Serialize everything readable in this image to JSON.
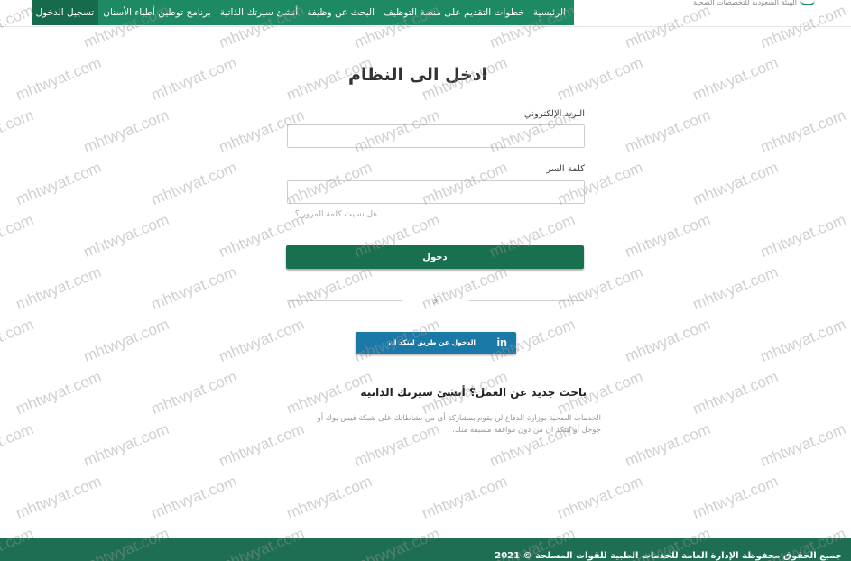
{
  "header": {
    "brand_text": "الهيئة السعودية للتخصصات الصحية",
    "nav_items": [
      {
        "label": "الرئيسية",
        "active": false
      },
      {
        "label": "خطوات التقديم على منصة التوظيف",
        "active": false
      },
      {
        "label": "البحث عن وظيفة",
        "active": false
      },
      {
        "label": "أنشئ سيرتك الذاتية",
        "active": false
      },
      {
        "label": "برنامج توطين أطباء الأسنان",
        "active": false
      },
      {
        "label": "تسجيل الدخول",
        "active": true
      }
    ]
  },
  "login": {
    "title": "ادخل الى النظام",
    "email_label": "البريد الإلكتروني",
    "email_value": "",
    "password_label": "كلمة السر",
    "password_value": "",
    "forgot_link": "هل نسيت كلمة المرور ؟",
    "submit_label": "دخول",
    "or_text": "أو",
    "linkedin_icon": "in",
    "linkedin_label": "الدخول عن طريق لينكد ان"
  },
  "promo": {
    "title": "باحث جديد عن العمل؟ أنشئ سيرتك الذاتية",
    "text": "الخدمات الصحية بوزارة الدفاع لن يقوم بمشاركة أي من نشاطاتك على شبكة فيس بوك أو جوجل أو لينكد ان من دون موافقة مسبقة منك."
  },
  "footer": {
    "copyright": "جميع الحقوق محفوظة الإدارة العامة للخدمات الطبية للقوات المسلحة © 2021"
  },
  "watermark": "mhtwyat.com",
  "colors": {
    "nav_bg": "#1e8a63",
    "nav_active": "#156b4b",
    "button": "#19704f",
    "linkedin": "#1b79a8",
    "footer": "#1d6e52"
  }
}
